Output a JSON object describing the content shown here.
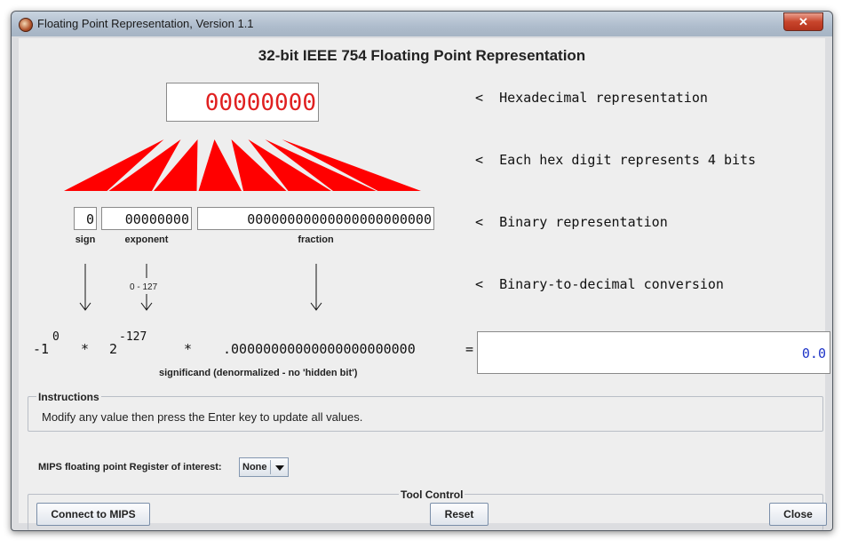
{
  "window": {
    "title": "Floating Point Representation, Version 1.1",
    "close_glyph": "✕"
  },
  "heading": "32-bit IEEE 754 Floating Point Representation",
  "hex_value": "00000000",
  "fields": {
    "sign_value": "0",
    "exponent_value": "00000000",
    "fraction_value": "00000000000000000000000",
    "sign_label": "sign",
    "exponent_label": "exponent",
    "fraction_label": "fraction"
  },
  "side_notes": [
    "<  Hexadecimal representation",
    "<  Each hex digit represents 4 bits",
    "<  Binary representation",
    "<  Binary-to-decimal conversion"
  ],
  "bias_note": "0 - 127",
  "formula": {
    "sign_base": "-1",
    "sign_exp": "0",
    "times1": "*",
    "base": "2",
    "exp": "-127",
    "times2": "*",
    "significand": ".00000000000000000000000",
    "equals": "=",
    "result": "0.0",
    "significand_label": "significand (denormalized - no 'hidden bit')"
  },
  "instructions": {
    "title": "Instructions",
    "text": "Modify any value then press the Enter key to update all values."
  },
  "mips": {
    "label": "MIPS floating point Register of interest:",
    "selected": "None"
  },
  "tool_control": {
    "title": "Tool Control",
    "connect": "Connect to MIPS",
    "reset": "Reset",
    "close": "Close"
  },
  "colors": {
    "hex_digits": "#e02020",
    "triangles": "#ff0000",
    "result_text": "#1f35c8"
  },
  "icons": {
    "app": "app-icon",
    "close": "close-icon",
    "dropdown": "chevron-down-icon",
    "arrows": "down-arrow-icon"
  }
}
